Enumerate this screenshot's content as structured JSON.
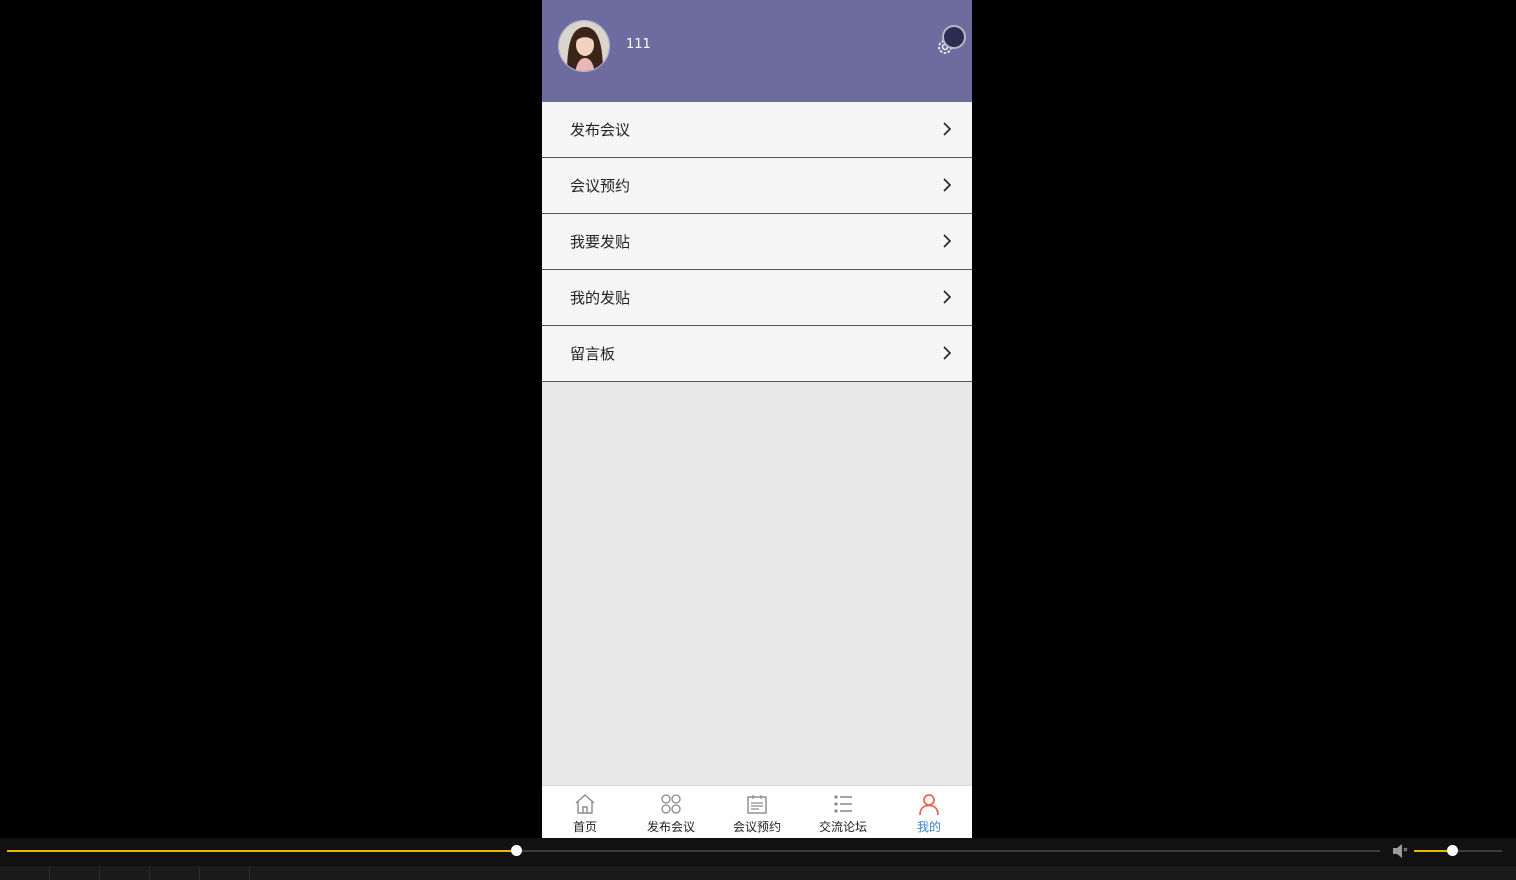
{
  "profile": {
    "username": "111",
    "header_color": "#6e6c9e"
  },
  "menu": {
    "items": [
      {
        "label": "发布会议"
      },
      {
        "label": "会议预约"
      },
      {
        "label": "我要发贴"
      },
      {
        "label": "我的发贴"
      },
      {
        "label": "留言板"
      }
    ]
  },
  "tabbar": {
    "tabs": [
      {
        "label": "首页",
        "icon": "home-icon"
      },
      {
        "label": "发布会议",
        "icon": "grid-icon"
      },
      {
        "label": "会议预约",
        "icon": "calendar-icon"
      },
      {
        "label": "交流论坛",
        "icon": "list-icon"
      },
      {
        "label": "我的",
        "icon": "user-icon",
        "active": true
      }
    ],
    "active_color": "#3a84c4"
  },
  "player": {
    "progress": 0.371,
    "volume": 0.44,
    "accent_color": "#e8b500"
  }
}
